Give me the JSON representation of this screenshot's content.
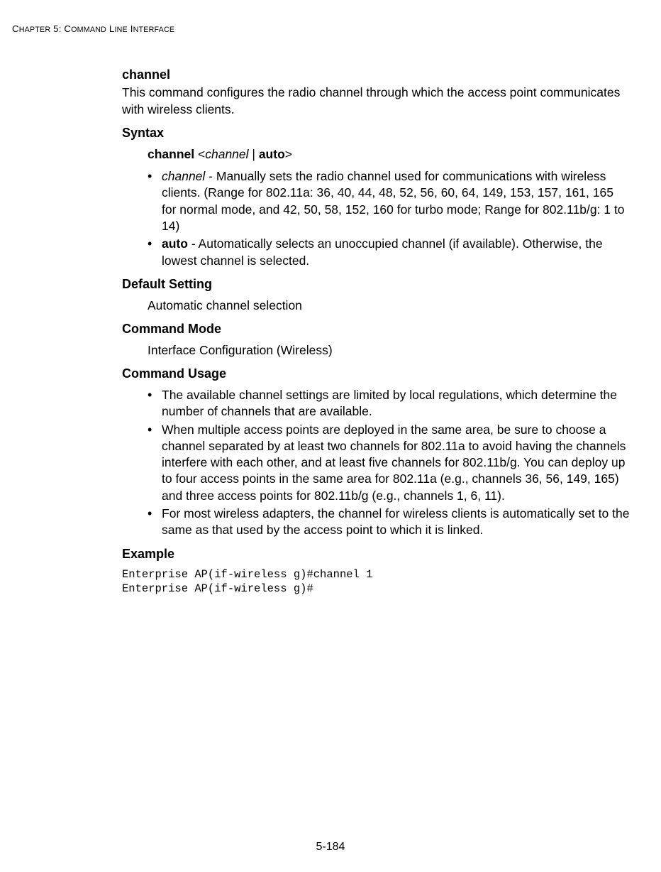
{
  "chapterHeader": {
    "prefixC": "C",
    "prefixRest": "HAPTER",
    "num": " 5: C",
    "titleRest": "OMMAND",
    "l": " L",
    "lRest": "INE",
    "i": " I",
    "iRest": "NTERFACE"
  },
  "cmd": {
    "name": "channel",
    "desc": "This command configures the radio channel through which the access point communicates with wireless clients."
  },
  "syntax": {
    "label": "Syntax",
    "line": {
      "cmd": "channel",
      "sep1": " <",
      "arg": "channel",
      "sep2": " | ",
      "auto": "auto",
      "close": ">"
    },
    "bullets": [
      {
        "lead": "channel",
        "leadItalic": true,
        "rest": " - Manually sets the radio channel used for communications with wireless clients. (Range for 802.11a: 36, 40, 44, 48, 52, 56, 60, 64, 149, 153, 157, 161, 165 for normal mode, and 42, 50, 58, 152, 160 for turbo mode; Range for 802.11b/g: 1 to 14)"
      },
      {
        "lead": "auto",
        "leadBold": true,
        "rest": " - Automatically selects an unoccupied channel (if available). Otherwise, the lowest channel is selected."
      }
    ]
  },
  "defaultSetting": {
    "label": "Default Setting",
    "value": "Automatic channel selection"
  },
  "commandMode": {
    "label": "Command Mode",
    "value": "Interface Configuration (Wireless)"
  },
  "commandUsage": {
    "label": "Command Usage",
    "bullets": [
      "The available channel settings are limited by local regulations, which determine the number of channels that are available.",
      "When multiple access points are deployed in the same area, be sure to choose a channel separated by at least two channels for 802.11a to avoid having the channels interfere with each other, and at least five channels for 802.11b/g. You can deploy up to four access points in the same area for 802.11a (e.g., channels 36, 56, 149, 165) and three access points for 802.11b/g (e.g., channels 1, 6, 11).",
      "For most wireless adapters, the channel for wireless clients is automatically set to the same as that used by the access point to which it is linked."
    ]
  },
  "example": {
    "label": "Example",
    "code": "Enterprise AP(if-wireless g)#channel 1\nEnterprise AP(if-wireless g)#"
  },
  "pageNum": "5-184"
}
